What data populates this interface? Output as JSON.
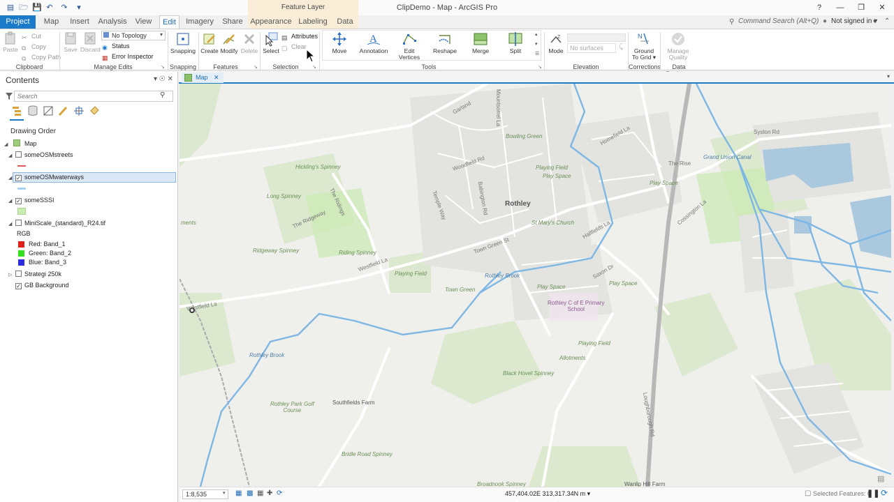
{
  "titlebar": {
    "app_title": "ClipDemo - Map - ArcGIS Pro",
    "context_title": "Feature Layer",
    "command_search": "Command Search (Alt+Q)",
    "signin": "Not signed in ▾",
    "help": "?",
    "minimize": "—",
    "restore": "❒",
    "close": "✕"
  },
  "tabs": [
    {
      "label": "Project"
    },
    {
      "label": "Map"
    },
    {
      "label": "Insert"
    },
    {
      "label": "Analysis"
    },
    {
      "label": "View"
    },
    {
      "label": "Edit"
    },
    {
      "label": "Imagery"
    },
    {
      "label": "Share"
    },
    {
      "label": "Appearance"
    },
    {
      "label": "Labeling"
    },
    {
      "label": "Data"
    }
  ],
  "ribbon": {
    "clipboard": {
      "paste": "Paste",
      "cut": "Cut",
      "copy": "Copy",
      "copy_path": "Copy Path",
      "label": "Clipboard"
    },
    "manage_edits": {
      "save": "Save",
      "discard": "Discard",
      "topology": "No Topology",
      "status": "Status",
      "error_inspector": "Error Inspector",
      "label": "Manage Edits"
    },
    "snapping": {
      "snapping": "Snapping",
      "label": "Snapping"
    },
    "features": {
      "create": "Create",
      "modify": "Modify",
      "delete": "Delete",
      "label": "Features"
    },
    "selection": {
      "select": "Select",
      "attributes": "Attributes",
      "clear": "Clear",
      "label": "Selection"
    },
    "tools": {
      "move": "Move",
      "annotation": "Annotation",
      "edit_vertices": "Edit\nVertices",
      "reshape": "Reshape",
      "merge": "Merge",
      "split": "Split",
      "label": "Tools"
    },
    "elevation": {
      "mode": "Mode",
      "surface": "No surfaces",
      "label": "Elevation"
    },
    "corrections": {
      "ground_to_grid": "Ground\nTo Grid ▾",
      "label": "Corrections"
    },
    "data_reviewer": {
      "manage_quality": "Manage\nQuality",
      "label": "Data Reviewer"
    }
  },
  "contents": {
    "title": "Contents",
    "pin": "▾ ☉ ✕",
    "search_placeholder": "Search",
    "drawing_order": "Drawing Order",
    "layers": [
      {
        "name": "Map",
        "checked": true
      },
      {
        "name": "someOSMstreets",
        "checked": false
      },
      {
        "name": "someOSMwaterways",
        "checked": true
      },
      {
        "name": "someSSSI",
        "checked": true
      },
      {
        "name": "MiniScale_(standard)_R24.tif",
        "checked": false
      },
      {
        "name": "Strategi 250k",
        "checked": false
      },
      {
        "name": "GB Background",
        "checked": true
      }
    ],
    "rgb": {
      "title": "RGB",
      "red": "Red:   Band_1",
      "green": "Green: Band_2",
      "blue": "Blue:  Band_3"
    }
  },
  "map": {
    "tab_label": "Map",
    "labels": {
      "rothley": "Rothley",
      "garland": "Garland",
      "mountsorrel": "Mountsorrel La",
      "bowling": "Bowling Green",
      "homefield": "Homefield La",
      "syston": "Syston Rd",
      "grand_union": "Grand Union Canal",
      "hicklings": "Hickling's Spinney",
      "woodfield": "Woodfield Rd",
      "playing_field1": "Playing Field",
      "play_space1": "Play Space",
      "the_rise": "The Rise",
      "play_space2": "Play Space",
      "long_spinney": "Long Spinney",
      "the_ridings": "The Ridings",
      "the_ridgeway": "The Ridgeway",
      "temple_way": "Temple Way",
      "babington": "Babington Rd",
      "stmarys": "St Mary's Church",
      "cossington": "Cossington La",
      "ridgeway_spinney": "Ridgeway Spinney",
      "riding_spinney": "Riding Spinney",
      "westfield1": "Westfield La",
      "town_green_st": "Town Green St",
      "hallfields": "Hallfields La",
      "playing_field2": "Playing Field",
      "rothley_brook1": "Rothley Brook",
      "saxon": "Saxon Dr",
      "town_green": "Town Green",
      "play_space3": "Play Space",
      "play_space4": "Play Space",
      "school": "Rothley C of E Primary\nSchool",
      "westfield2": "Westfield La",
      "playing_field3": "Playing Field",
      "rothley_brook2": "Rothley Brook",
      "allotments": "Allotments",
      "black_hovel": "Black Hovel Spinney",
      "golf": "Rothley Park Golf\nCourse",
      "southfields": "Southfields Farm",
      "bridle_road": "Bridle Road Spinney",
      "broadnook": "Broadnook Spinney",
      "wanlip": "Wanlip Hill Farm",
      "loughborough": "Loughborough Rd",
      "ments": "ments"
    }
  },
  "status": {
    "scale": "1:8,535",
    "coords": "457,404.02E 313,317.34N m ▾",
    "selected": "Selected Features: 0"
  },
  "colors": {
    "accent": "#1c7bc8",
    "context_tab": "#f9edd8",
    "water": "#7eb7e4",
    "sssi": "#c7edb0"
  }
}
